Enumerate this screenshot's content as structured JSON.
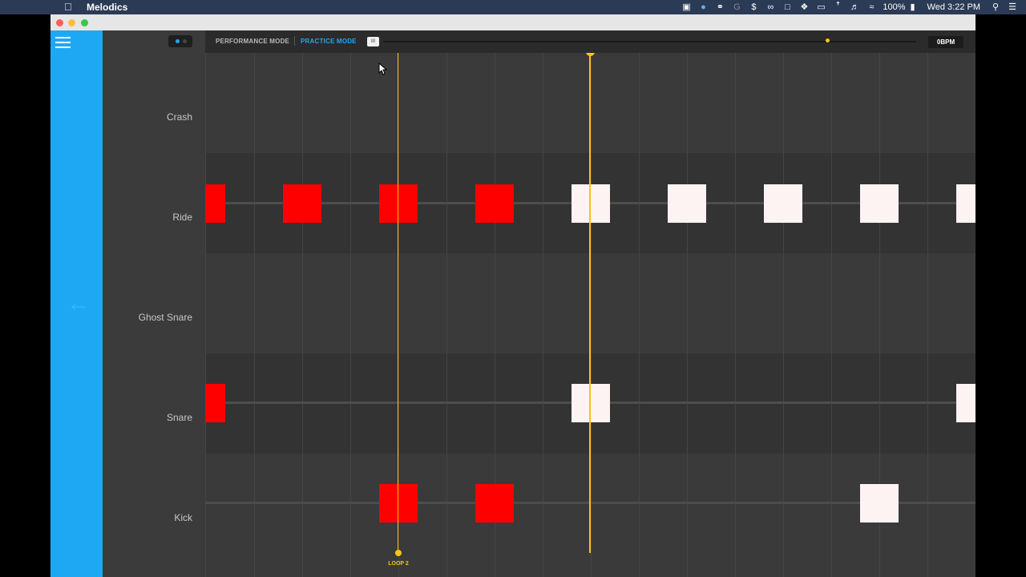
{
  "menubar": {
    "app_name": "Melodics",
    "battery": "100%",
    "clock": "Wed 3:22 PM"
  },
  "header": {
    "performance_mode": "PERFORMANCE MODE",
    "practice_mode": "PRACTICE MODE",
    "bpm": "0BPM"
  },
  "lanes": [
    {
      "label": "Crash"
    },
    {
      "label": "Ride"
    },
    {
      "label": "Ghost Snare"
    },
    {
      "label": "Snare"
    },
    {
      "label": "Kick"
    }
  ],
  "loop_label": "LOOP 2",
  "colors": {
    "accent": "#1ea8f4",
    "playhead": "#f5c518",
    "note_hit": "#ff0000",
    "note_pending": "#fdf3f3"
  }
}
